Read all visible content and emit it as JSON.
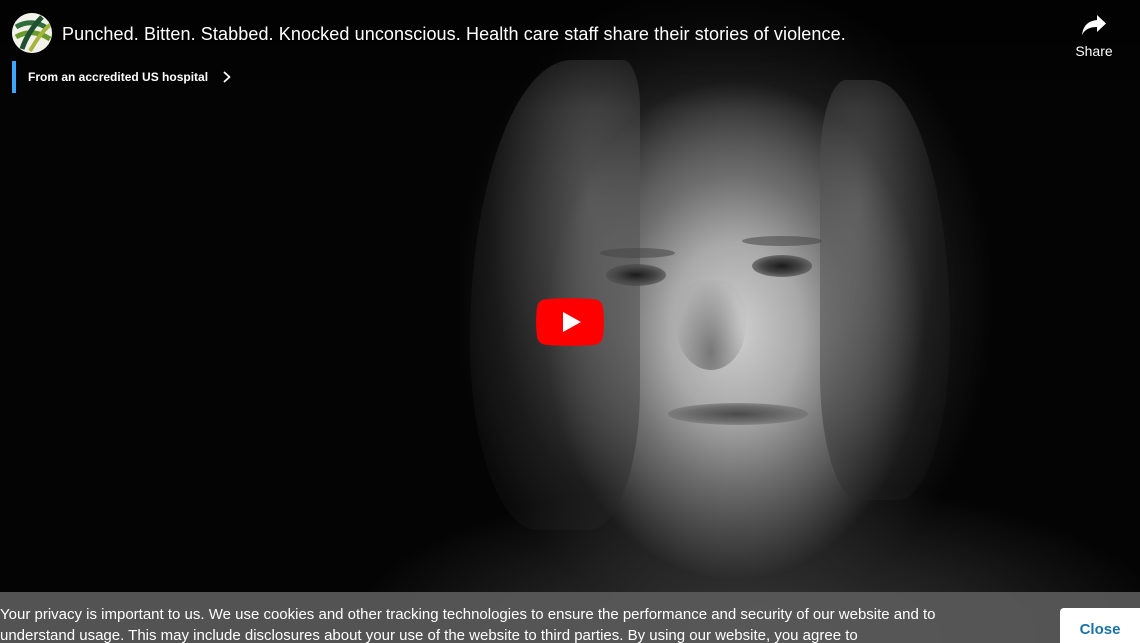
{
  "video": {
    "title": "Punched. Bitten. Stabbed. Knocked unconscious. Health care staff share their stories of violence.",
    "share_label": "Share",
    "info_panel_text": "From an accredited US hospital"
  },
  "privacy_banner": {
    "text": "Your privacy is important to us. We use cookies and other tracking technologies to ensure the performance and security of our website and to understand usage. This may include disclosures about your use of the website to third parties. By using our website, you agree to",
    "close_label": "Close"
  },
  "colors": {
    "play_button": "#ff0000",
    "info_panel_accent": "#3ea6ff",
    "close_text": "#1a72a8",
    "banner_background": "#5a5a5a"
  },
  "icons": {
    "avatar": "channel-logo-icon",
    "share": "share-arrow-icon",
    "info": "chevron-right-icon",
    "play": "youtube-play-icon"
  }
}
